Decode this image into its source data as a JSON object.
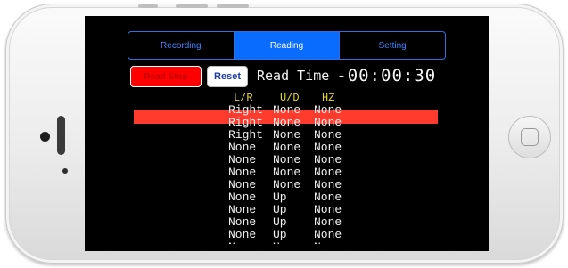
{
  "tabs": [
    "Recording",
    "Reading",
    "Setting"
  ],
  "active_tab": "Reading",
  "controls": {
    "stop_label": "Read Stop",
    "reset_label": "Reset",
    "read_time_label": "Read Time",
    "read_time_value": "-00:00:30"
  },
  "columns": [
    "L/R",
    "U/D",
    "HZ"
  ],
  "rows": [
    [
      "Right",
      "None",
      "None"
    ],
    [
      "Right",
      "None",
      "None"
    ],
    [
      "Right",
      "None",
      "None"
    ],
    [
      "None",
      "None",
      "None"
    ],
    [
      "None",
      "None",
      "None"
    ],
    [
      "None",
      "None",
      "None"
    ],
    [
      "None",
      "None",
      "None"
    ],
    [
      "None",
      "Up",
      "None"
    ],
    [
      "None",
      "Up",
      "None"
    ],
    [
      "None",
      "Up",
      "None"
    ],
    [
      "None",
      "Up",
      "None"
    ],
    [
      "None",
      "Up",
      "None"
    ]
  ],
  "colors": {
    "active_tab": "#0a6bff",
    "stop_button": "#ff0000",
    "highlight_row": "#ff3b2e",
    "column_header": "#e6d92a"
  }
}
